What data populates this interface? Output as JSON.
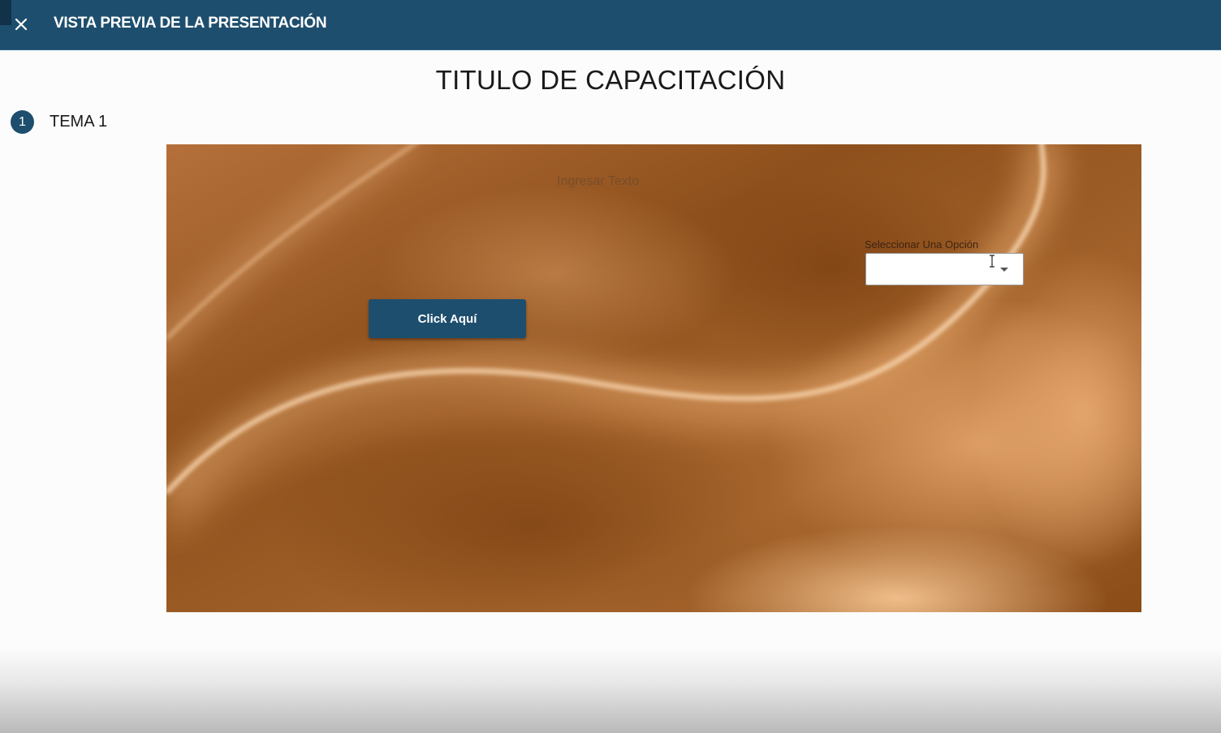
{
  "window": {
    "title": "VISTA PREVIA DE LA PRESENTACIÓN",
    "close_icon": "close-icon"
  },
  "presentation": {
    "title": "TITULO DE CAPACITACIÓN",
    "topic": {
      "number": "1",
      "label": "TEMA 1"
    }
  },
  "slide": {
    "text_placeholder": "Ingresar Texto",
    "button_label": "Click Aquí",
    "select": {
      "label": "Seleccionar Una Opción",
      "value": "",
      "caret_icon": "caret-down-icon"
    }
  },
  "colors": {
    "header": "#1e4e6e",
    "primary_button": "#1e4e6e",
    "slide_background": "#8f5220"
  }
}
